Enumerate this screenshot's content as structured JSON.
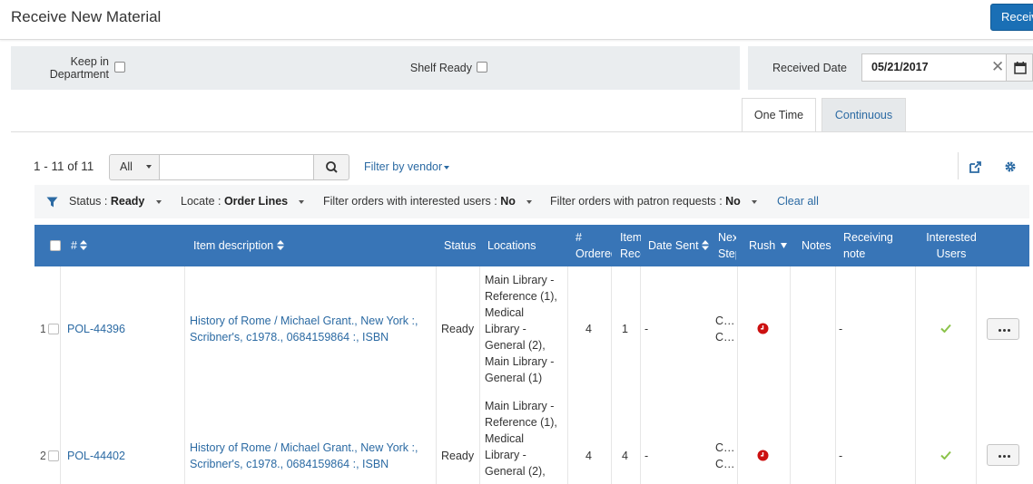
{
  "header": {
    "title": "Receive New Material",
    "receive_button": "Receive"
  },
  "options": {
    "keep_in_department_line1": "Keep in",
    "keep_in_department_line2": "Department",
    "shelf_ready": "Shelf Ready",
    "received_date_label": "Received Date",
    "received_date_value": "05/21/2017"
  },
  "tabs": [
    {
      "label": "One Time",
      "active": true
    },
    {
      "label": "Continuous",
      "active": false
    }
  ],
  "toolbar": {
    "count": "1 - 11 of 11",
    "scope": "All",
    "search_value": "",
    "filter_vendor": "Filter by vendor"
  },
  "filters": [
    {
      "label": "Status : ",
      "value": "Ready"
    },
    {
      "label": "Locate : ",
      "value": "Order Lines"
    },
    {
      "label": "Filter orders with interested users : ",
      "value": "No"
    },
    {
      "label": "Filter orders with patron requests : ",
      "value": "No"
    }
  ],
  "clear_all": "Clear all",
  "columns": {
    "num": "#",
    "item_description": "Item description",
    "status": "Status",
    "locations": "Locations",
    "ordered_1": "#",
    "ordered_2": "Ordered",
    "items_received_1": "Items",
    "items_received_2": "Received",
    "date_sent": "Date Sent",
    "next_step_1": "Next",
    "next_step_2": "Step",
    "rush": "Rush",
    "notes": "Notes",
    "receiving_note_1": "Receiving",
    "receiving_note_2": "note",
    "interested_users_1": "Interested",
    "interested_users_2": "Users"
  },
  "rows": [
    {
      "index": "1",
      "pol": "POL-44396",
      "desc_line1": "History of Rome / Michael Grant., New York :,",
      "desc_line2": "Scribner's, c1978., 0684159864 :, ISBN",
      "status": "Ready",
      "locations": [
        "Main Library -",
        "Reference (1),",
        "Medical",
        "Library -",
        "General (2),",
        "Main Library -",
        "General (1)"
      ],
      "ordered": "4",
      "received": "1",
      "date_sent": "-",
      "next_step_1": "C…",
      "next_step_2": "C…",
      "receiving_note": "-"
    },
    {
      "index": "2",
      "pol": "POL-44402",
      "desc_line1": "History of Rome / Michael Grant., New York :,",
      "desc_line2": "Scribner's, c1978., 0684159864 :, ISBN",
      "status": "Ready",
      "locations": [
        "Main Library -",
        "Reference (1),",
        "Medical",
        "Library -",
        "General (2),"
      ],
      "ordered": "4",
      "received": "4",
      "date_sent": "-",
      "next_step_1": "C…",
      "next_step_2": "C…",
      "receiving_note": "-"
    }
  ],
  "colors": {
    "primary": "#1a6fb5",
    "header_bg": "#3875b7",
    "link": "#2b6aa3",
    "rush": "#cc1111",
    "check": "#8bc34a"
  },
  "icons": [
    "search-icon",
    "calendar-icon",
    "clear-icon",
    "filter-icon",
    "export-icon",
    "gear-icon",
    "sort-icon",
    "rush-clock-icon",
    "checkmark-icon",
    "more-icon"
  ]
}
